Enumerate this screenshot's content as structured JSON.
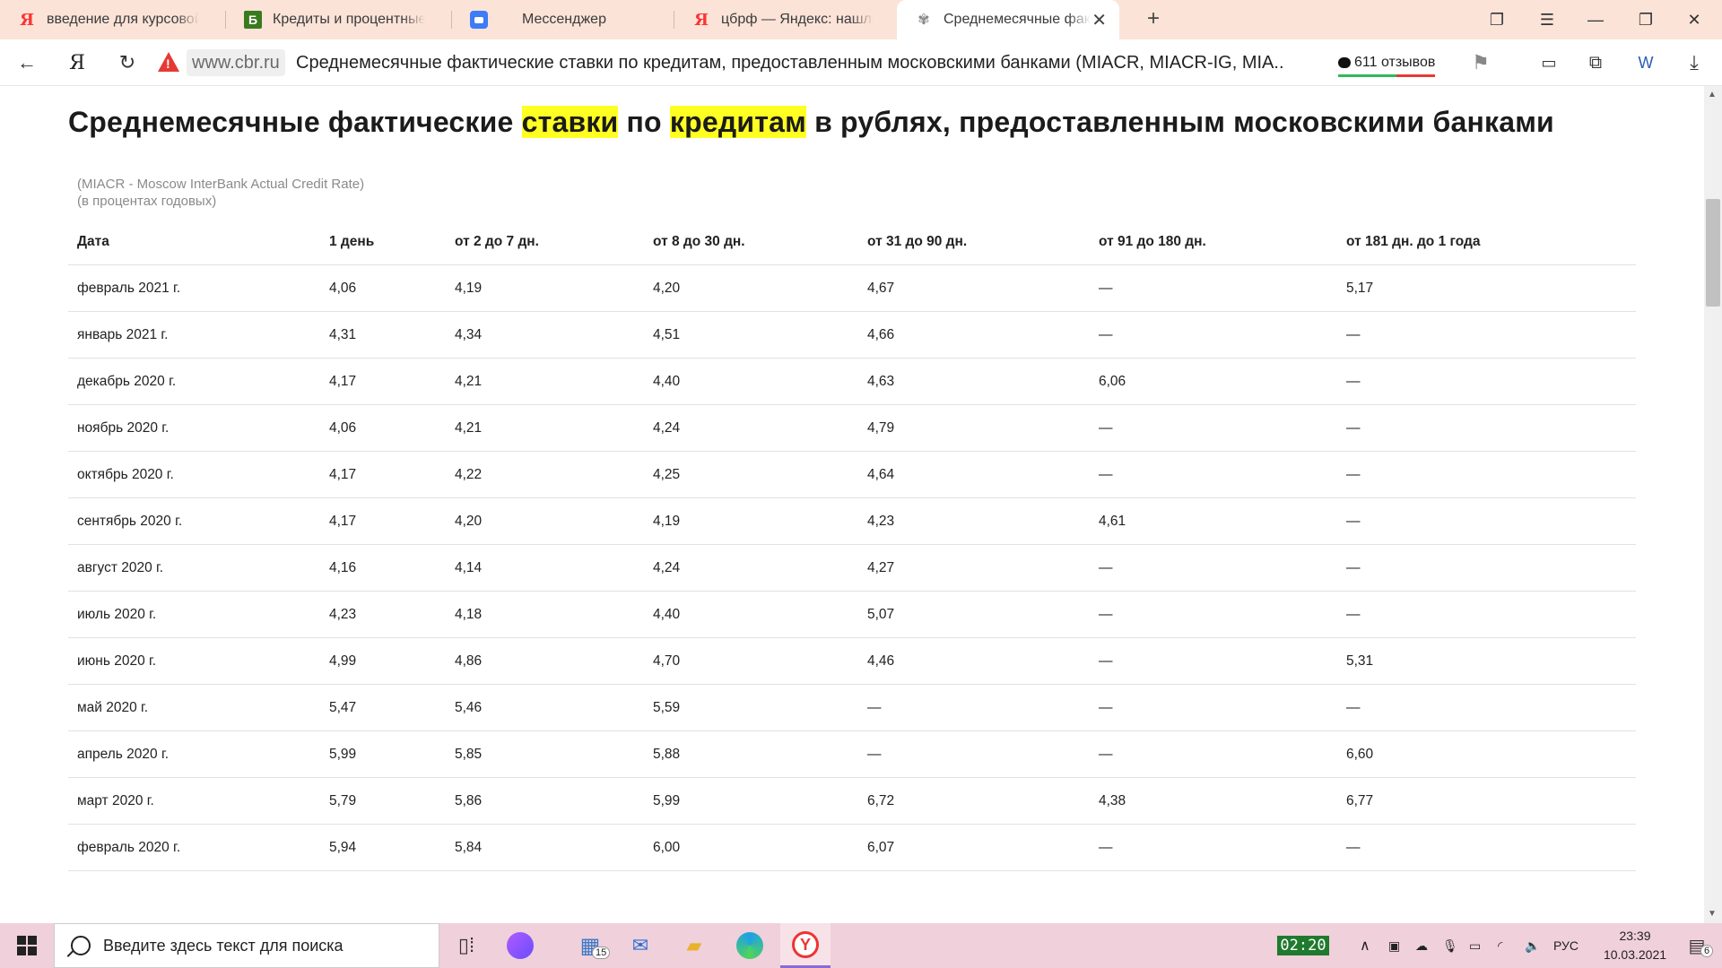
{
  "browser": {
    "tabs": [
      {
        "title": "введение для курсовой р",
        "favicon": "yandex-icon"
      },
      {
        "title": "Кредиты и процентные с",
        "favicon": "b-site-icon"
      },
      {
        "title": "Мессенджер",
        "favicon": "messenger-icon"
      },
      {
        "title": "цбрф — Яндекс: нашлось",
        "favicon": "yandex-icon"
      },
      {
        "title": "Среднемесячные факт",
        "favicon": "cbr-icon",
        "active": true
      }
    ],
    "newtab_symbol": "+",
    "address": {
      "domain": "www.cbr.ru",
      "page_title": "Среднемесячные фактические ставки по кредитам, предоставленным московскими банками (MIACR, MIACR-IG, MIA...",
      "reviews": "611 отзывов"
    }
  },
  "page": {
    "heading": {
      "part1": "Среднемесячные фактические ",
      "hl1": "ставки",
      "part2": " по ",
      "hl2": "кредитам",
      "part3": " в рублях, предоставленным московскими банками"
    },
    "subtitle_line1": "(MIACR - Moscow InterBank Actual Credit Rate)",
    "subtitle_line2": "(в процентах годовых)",
    "table": {
      "headers": [
        "Дата",
        "1 день",
        "от 2 до 7 дн.",
        "от 8 до 30 дн.",
        "от 31 до 90 дн.",
        "от 91 до 180 дн.",
        "от 181 дн. до 1 года"
      ],
      "rows": [
        [
          "февраль 2021 г.",
          "4,06",
          "4,19",
          "4,20",
          "4,67",
          "—",
          "5,17"
        ],
        [
          "январь 2021 г.",
          "4,31",
          "4,34",
          "4,51",
          "4,66",
          "—",
          "—"
        ],
        [
          "декабрь 2020 г.",
          "4,17",
          "4,21",
          "4,40",
          "4,63",
          "6,06",
          "—"
        ],
        [
          "ноябрь 2020 г.",
          "4,06",
          "4,21",
          "4,24",
          "4,79",
          "—",
          "—"
        ],
        [
          "октябрь 2020 г.",
          "4,17",
          "4,22",
          "4,25",
          "4,64",
          "—",
          "—"
        ],
        [
          "сентябрь 2020 г.",
          "4,17",
          "4,20",
          "4,19",
          "4,23",
          "4,61",
          "—"
        ],
        [
          "август 2020 г.",
          "4,16",
          "4,14",
          "4,24",
          "4,27",
          "—",
          "—"
        ],
        [
          "июль 2020 г.",
          "4,23",
          "4,18",
          "4,40",
          "5,07",
          "—",
          "—"
        ],
        [
          "июнь 2020 г.",
          "4,99",
          "4,86",
          "4,70",
          "4,46",
          "—",
          "5,31"
        ],
        [
          "май 2020 г.",
          "5,47",
          "5,46",
          "5,59",
          "—",
          "—",
          "—"
        ],
        [
          "апрель 2020 г.",
          "5,99",
          "5,85",
          "5,88",
          "—",
          "—",
          "6,60"
        ],
        [
          "март 2020 г.",
          "5,79",
          "5,86",
          "5,99",
          "6,72",
          "4,38",
          "6,77"
        ],
        [
          "февраль 2020 г.",
          "5,94",
          "5,84",
          "6,00",
          "6,07",
          "—",
          "—"
        ]
      ]
    }
  },
  "taskbar": {
    "search_placeholder": "Введите здесь текст для поиска",
    "explorer_badge": "15",
    "timer": "02:20",
    "language": "РУС",
    "time": "23:39",
    "date": "10.03.2021",
    "notifications_badge": "6"
  }
}
